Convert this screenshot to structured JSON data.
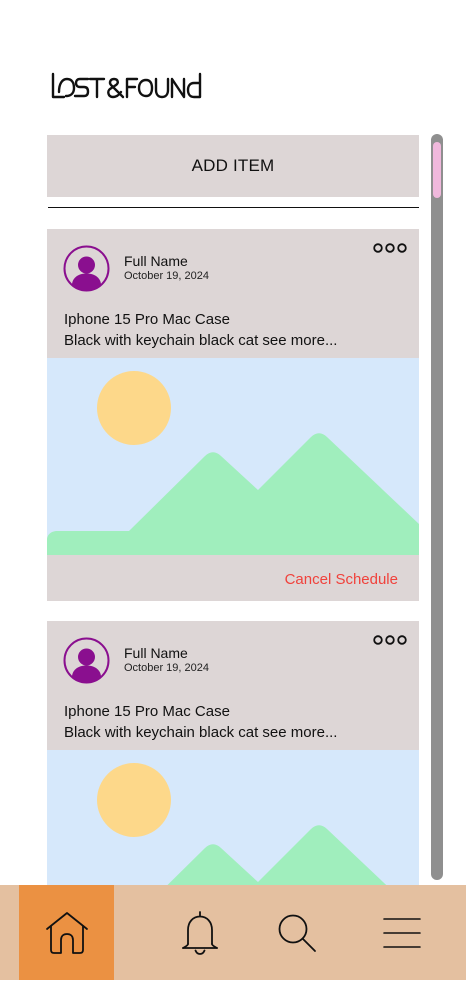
{
  "app": {
    "logo_text": "LOST&FOUND"
  },
  "toolbar": {
    "add_item_label": "ADD ITEM"
  },
  "posts": [
    {
      "author": "Full Name",
      "date": "October 19, 2024",
      "title": "Iphone 15 Pro Mac Case",
      "description": "Black with keychain black cat see more...",
      "action_label": "Cancel Schedule",
      "image_icon": "image-placeholder"
    },
    {
      "author": "Full Name",
      "date": "October 19, 2024",
      "title": "Iphone 15 Pro Mac Case",
      "description": "Black with keychain black cat see more...",
      "image_icon": "image-placeholder"
    }
  ],
  "nav": {
    "items": [
      {
        "icon": "home-icon",
        "active": true
      },
      {
        "icon": "bell-icon",
        "active": false
      },
      {
        "icon": "search-icon",
        "active": false
      },
      {
        "icon": "menu-icon",
        "active": false
      }
    ]
  },
  "colors": {
    "card_bg": "#ddd6d6",
    "accent_active": "#eb9142",
    "navbar_bg": "#e4c0a0",
    "cancel_text": "#f0423c",
    "avatar": "#8a0f8f",
    "image_sky": "#d6e8fb",
    "image_sun": "#fdd88a",
    "image_hills": "#a0eebd",
    "scroll_thumb": "#f0b8dc"
  }
}
